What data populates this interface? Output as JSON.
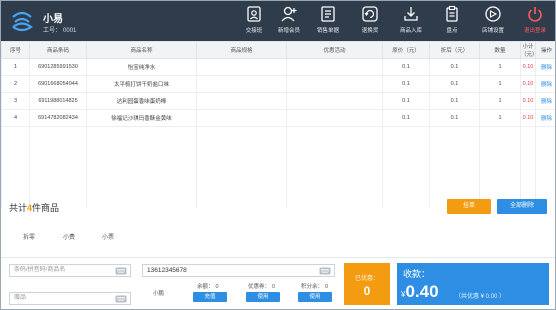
{
  "header": {
    "user_name": "小易",
    "user_id_label": "工号：",
    "user_id": "0001",
    "tools": [
      {
        "icon": "exchange-shift-icon",
        "label": "交接班"
      },
      {
        "icon": "add-member-icon",
        "label": "新增会员"
      },
      {
        "icon": "sales-orders-icon",
        "label": "销售单据"
      },
      {
        "icon": "refund-icon",
        "label": "退换货"
      },
      {
        "icon": "stock-in-icon",
        "label": "商品入库"
      },
      {
        "icon": "inventory-check-icon",
        "label": "盘点"
      },
      {
        "icon": "store-settings-icon",
        "label": "店铺设置"
      },
      {
        "icon": "power-icon",
        "label": "退出登录"
      }
    ]
  },
  "table": {
    "columns": [
      "序号",
      "商品条码",
      "商品名称",
      "商品规格",
      "优惠活动",
      "原价（元）",
      "折后（元）",
      "数量",
      "小计（元）",
      "操作"
    ],
    "rows": [
      {
        "no": "1",
        "barcode": "6901285991530",
        "name": "怡宝纯净水",
        "spec": "",
        "promo": "",
        "price": "0.1",
        "discounted": "0.1",
        "qty": "1",
        "subtotal": "0.10",
        "action": "删除"
      },
      {
        "no": "2",
        "barcode": "6901668054944",
        "name": "太平梳打饼干奶盐口味",
        "spec": "",
        "promo": "",
        "price": "0.1",
        "discounted": "0.1",
        "qty": "1",
        "subtotal": "0.10",
        "action": "删除"
      },
      {
        "no": "3",
        "barcode": "6911988014825",
        "name": "达利园蛋香味蛋奶棒",
        "spec": "",
        "promo": "",
        "price": "0.1",
        "discounted": "0.1",
        "qty": "1",
        "subtotal": "0.10",
        "action": "删除"
      },
      {
        "no": "4",
        "barcode": "6914782082434",
        "name": "徐福记沙琪玛香酥金黄味",
        "spec": "",
        "promo": "",
        "price": "0.1",
        "discounted": "0.1",
        "qty": "1",
        "subtotal": "0.10",
        "action": "删除"
      }
    ]
  },
  "summary": {
    "prefix": "共计",
    "count": "4",
    "suffix": "件商品",
    "order_button": "挂单",
    "delete_all_button": "全部删除"
  },
  "tabs": [
    "拆零",
    "小费",
    "小票"
  ],
  "inputs": {
    "search_placeholder": "条码/拼音码/商品名",
    "name_placeholder": "赠品",
    "phone_value": "13612345678"
  },
  "member": {
    "label": "小鹏",
    "balances": [
      {
        "label": "余额：",
        "value": "0",
        "button": "充值"
      },
      {
        "label": "优惠券：",
        "value": "0",
        "button": "使用"
      },
      {
        "label": "积分余：",
        "value": "0",
        "button": "使用"
      }
    ]
  },
  "payable": {
    "label": "已优惠：",
    "value": "0"
  },
  "receive": {
    "label": "收款：",
    "currency": "¥",
    "amount": "0.40",
    "discount_text": "（共优惠 ¥ 0.00 ）"
  },
  "colors": {
    "header_bg": "#2f3c4c",
    "accent_orange": "#f39c12",
    "accent_blue": "#2d8ee3",
    "subtotal_red": "#e03b3b",
    "exit_red": "#ff5a5a"
  }
}
